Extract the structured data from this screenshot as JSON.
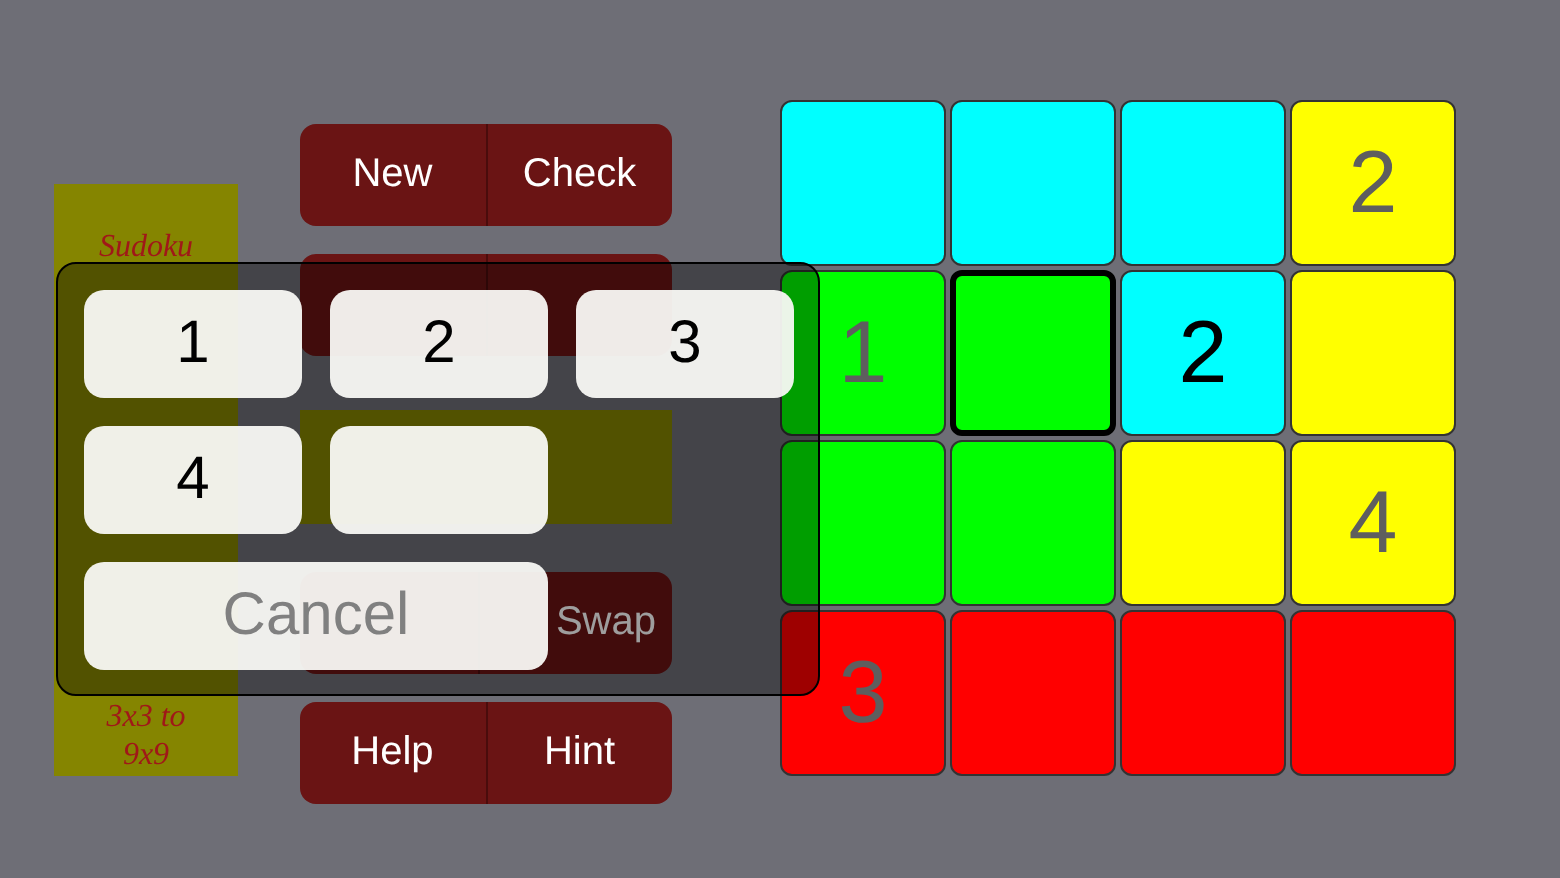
{
  "sidebar": {
    "title": "Sudoku",
    "subtitle_lines": [
      "3x3 to",
      "9x9"
    ]
  },
  "controls": [
    {
      "kind": "pair",
      "left": "New",
      "right": "Check"
    },
    {
      "kind": "pair"
    },
    {
      "kind": "banner"
    },
    {
      "kind": "pair",
      "right": "Swap"
    },
    {
      "kind": "pair",
      "left": "Help",
      "right": "Hint"
    }
  ],
  "grid": {
    "rows": [
      [
        {
          "color": "#00ffff",
          "selected": false
        },
        {
          "color": "#00ffff",
          "selected": false
        },
        {
          "color": "#00ffff",
          "selected": false
        },
        {
          "color": "#ffff00",
          "value": "2",
          "kind": "given",
          "selected": false
        }
      ],
      [
        {
          "color": "#00ff00",
          "value": "1",
          "kind": "given",
          "selected": false
        },
        {
          "color": "#00ff00",
          "selected": true
        },
        {
          "color": "#00ffff",
          "value": "2",
          "kind": "entered",
          "selected": false
        },
        {
          "color": "#ffff00",
          "selected": false
        }
      ],
      [
        {
          "color": "#00ff00",
          "selected": false
        },
        {
          "color": "#00ff00",
          "selected": false
        },
        {
          "color": "#ffff00",
          "selected": false
        },
        {
          "color": "#ffff00",
          "value": "4",
          "kind": "given",
          "selected": false
        }
      ],
      [
        {
          "color": "#ff0000",
          "value": "3",
          "kind": "given",
          "selected": false
        },
        {
          "color": "#ff0000",
          "selected": false
        },
        {
          "color": "#ff0000",
          "selected": false
        },
        {
          "color": "#ff0000",
          "selected": false
        }
      ]
    ]
  },
  "picker": {
    "keys": [
      {
        "kind": "digit",
        "label": "1"
      },
      {
        "kind": "digit",
        "label": "2"
      },
      {
        "kind": "digit",
        "label": "3"
      },
      {
        "kind": "digit",
        "label": "4"
      },
      {
        "kind": "blank"
      }
    ],
    "cancel": "Cancel"
  }
}
